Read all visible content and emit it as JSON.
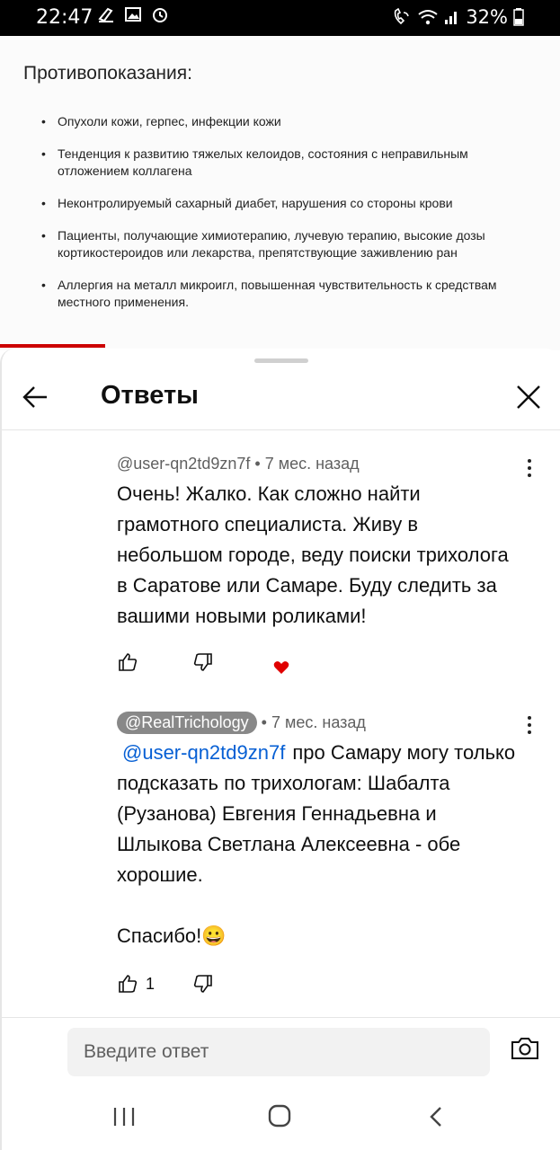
{
  "status_bar": {
    "time": "22:47",
    "battery": "32%",
    "icons": [
      "sound-off-icon",
      "image-icon",
      "alarm-icon",
      "wifi-call-icon",
      "wifi-icon",
      "signal-icon",
      "battery-icon"
    ]
  },
  "background": {
    "title": "Противопоказания:",
    "items": [
      "Опухоли кожи, герпес, инфекции кожи",
      "Тенденция к развитию тяжелых келоидов, состояния с неправильным отложением коллагена",
      "Неконтролируемый сахарный диабет, нарушения со стороны крови",
      "Пациенты, получающие химиотерапию, лучевую терапию, высокие дозы кортикостероидов или лекарства, препятствующие заживлению ран",
      "Аллергия на металл микроигл, повышенная чувствительность к средствам местного применения."
    ]
  },
  "sheet": {
    "title": "Ответы",
    "comments": [
      {
        "author": "@user-qn2td9zn7f",
        "time": "7 мес. назад",
        "text": "Очень! Жалко. Как сложно найти грамотного специалиста. Живу в небольшом городе, веду поиски трихолога в Саратове или Самаре. Буду следить за  вашими новыми роликами!",
        "likes": "",
        "hearted": true
      },
      {
        "author": "@RealTrichology",
        "time": "7 мес. назад",
        "mention": "@user-qn2td9zn7f",
        "text": "про Самару могу только подсказать по трихологам: Шабалта (Рузанова) Евгения Геннадьевна и Шлыкова Светлана Алексеевна - обе хорошие.",
        "text2": "Спасибо!😀",
        "likes": "1"
      }
    ]
  },
  "reply": {
    "placeholder": "Введите ответ"
  },
  "colors": {
    "mention": "#065fd4",
    "heart": "#e00000",
    "progress": "#cc0000"
  }
}
